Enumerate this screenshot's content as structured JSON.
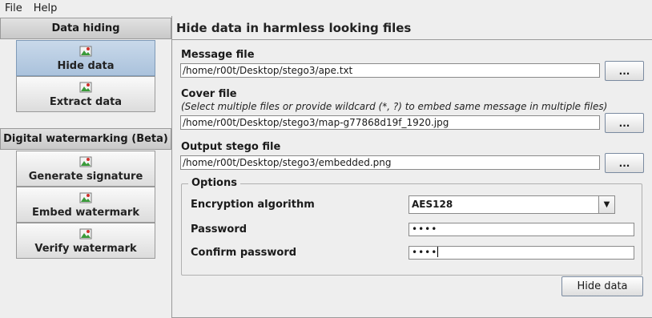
{
  "menu": {
    "file": "File",
    "help": "Help"
  },
  "sidebar": {
    "section1": "Data hiding",
    "hide_data": "Hide data",
    "extract_data": "Extract data",
    "section2": "Digital watermarking (Beta)",
    "generate_signature": "Generate signature",
    "embed_watermark": "Embed watermark",
    "verify_watermark": "Verify watermark"
  },
  "main": {
    "title": "Hide data in harmless looking files",
    "message_label": "Message file",
    "message_value": "/home/r00t/Desktop/stego3/ape.txt",
    "cover_label": "Cover file",
    "cover_hint": "(Select multiple files or provide wildcard (*, ?) to embed same message in multiple files)",
    "cover_value": "/home/r00t/Desktop/stego3/map-g77868d19f_1920.jpg",
    "output_label": "Output stego file",
    "output_value": "/home/r00t/Desktop/stego3/embedded.png",
    "browse_label": "...",
    "options_legend": "Options",
    "encryption_label": "Encryption algorithm",
    "encryption_value": "AES128",
    "password_label": "Password",
    "password_value": "••••",
    "confirm_label": "Confirm password",
    "confirm_value": "••••",
    "hide_button": "Hide data"
  }
}
